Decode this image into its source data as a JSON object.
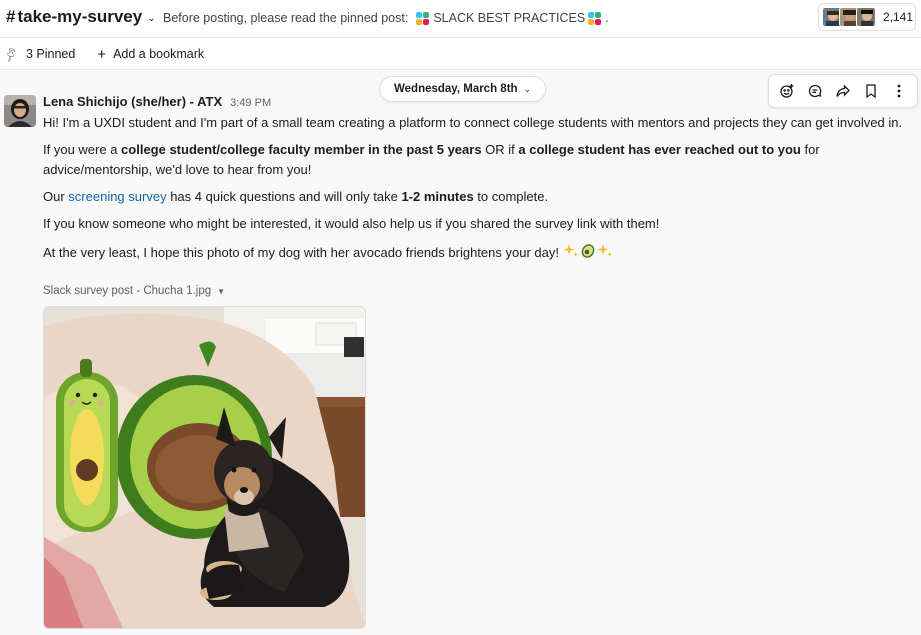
{
  "header": {
    "channel_hash": "#",
    "channel_name": "take-my-survey",
    "topic_prefix": "Before posting, please read the pinned post:",
    "pinned_post_title": "SLACK BEST PRACTICES",
    "topic_suffix": ".",
    "member_count": "2,141"
  },
  "bookmarks": {
    "pinned_label": "3 Pinned",
    "add_label": "Add a bookmark"
  },
  "date_divider": "Wednesday, March 8th",
  "message": {
    "sender": "Lena Shichijo (she/her) - ATX",
    "time": "3:49 PM",
    "p1": "Hi! I'm a UXDI student and I'm part of a small team creating a platform to connect college students with mentors and projects they can get involved in.",
    "p2_a": "If you were a ",
    "p2_b": "college student/college faculty member in the past 5 years",
    "p2_c": " OR if ",
    "p2_d": "a college student has ever reached out to you",
    "p2_e": " for advice/mentorship, we'd love to hear from you!",
    "p3_a": "Our ",
    "p3_link": "screening survey",
    "p3_b": " has 4 quick questions and will only take ",
    "p3_c": "1-2 minutes",
    "p3_d": " to complete.",
    "p4": "If you know someone who might be interested, it would also help us if you shared the survey link with them!",
    "p5": "At the very least, I hope this photo of my dog with her avocado friends brightens your day!",
    "file_name": "Slack survey post - Chucha 1.jpg"
  },
  "icons": [
    "pin-icon",
    "plus-icon",
    "add-reaction-icon",
    "reply-thread-icon",
    "share-icon",
    "bookmark-icon",
    "more-actions-icon",
    "sparkles-icon",
    "avocado-icon",
    "chevron-down-icon"
  ],
  "colors": {
    "link": "#1264a3",
    "text": "#1d1c1d",
    "muted": "#616061",
    "area_bg": "#f8f8f8"
  }
}
